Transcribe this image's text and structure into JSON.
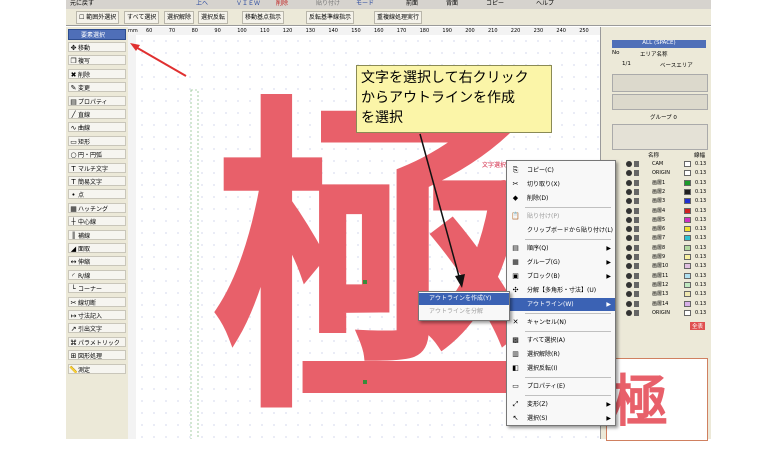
{
  "toolbar_top": {
    "back_label": "元に戻す",
    "items": [
      "上へ",
      "ＶＩＥＷ",
      "削除",
      "貼り付け",
      "モード",
      "前面",
      "背面",
      "コピー",
      "ヘルプ"
    ]
  },
  "toolbar_second": {
    "range_select": "範囲外選択",
    "select_all": "すべて選択",
    "deselect": "選択解除",
    "reverse": "選択反転",
    "move_base": "移動基点指示",
    "reverse_base": "反転基準線指示",
    "duplicate": "重複線処理実行"
  },
  "palette": {
    "select_label": "要素選択",
    "tools": [
      "移動",
      "複写",
      "削除",
      "変更",
      "プロパティ",
      "直線",
      "曲線",
      "矩形",
      "円・円弧",
      "マルチ文字",
      "簡易文字",
      "点",
      "ハッチング",
      "中心線",
      "補線",
      "面取",
      "伸縮",
      "R/線",
      "コーナー",
      "線切断",
      "寸法記入",
      "引出文字",
      "パラメトリック",
      "図形処理",
      "測定"
    ]
  },
  "ruler": {
    "unit": "mm",
    "ticks": [
      "60",
      "70",
      "80",
      "90",
      "100",
      "110",
      "120",
      "130",
      "140",
      "150",
      "160",
      "170",
      "180",
      "190",
      "200",
      "210",
      "220",
      "230",
      "240",
      "250"
    ]
  },
  "canvas": {
    "big_character": "極",
    "selection_label": "文字選択"
  },
  "callout": {
    "lines": [
      "文字を選択して右クリック",
      "からアウトラインを作成",
      "を選択"
    ]
  },
  "context_menu": {
    "items": [
      {
        "label": "コピー(C)",
        "icon": "copy-icon",
        "disabled": false
      },
      {
        "label": "切り取り(X)",
        "icon": "scissors-icon",
        "disabled": false
      },
      {
        "label": "削除(D)",
        "icon": "delete-icon",
        "disabled": false
      },
      {
        "label": "貼り付け(P)",
        "icon": "paste-icon",
        "disabled": true
      },
      {
        "label": "クリップボードから貼り付け(L)",
        "icon": "",
        "disabled": false
      },
      {
        "label": "順序(Q)",
        "icon": "order-icon",
        "disabled": false,
        "submenu": true
      },
      {
        "label": "グループ(G)",
        "icon": "group-icon",
        "disabled": false,
        "submenu": true
      },
      {
        "label": "ブロック(B)",
        "icon": "block-icon",
        "disabled": false,
        "submenu": true
      },
      {
        "label": "分解【多角形・寸法】(U)",
        "icon": "explode-icon",
        "disabled": false
      },
      {
        "label": "アウトライン(W)",
        "icon": "",
        "disabled": false,
        "submenu": true,
        "highlight": true
      },
      {
        "label": "キャンセル(N)",
        "icon": "cancel-icon",
        "disabled": false
      },
      {
        "label": "すべて選択(A)",
        "icon": "select-all-icon",
        "disabled": false
      },
      {
        "label": "選択解除(R)",
        "icon": "deselect-icon",
        "disabled": false
      },
      {
        "label": "選択反転(I)",
        "icon": "invert-icon",
        "disabled": false
      },
      {
        "label": "プロパティ(E)",
        "icon": "properties-icon",
        "disabled": false
      },
      {
        "label": "変形(Z)",
        "icon": "transform-icon",
        "disabled": false,
        "submenu": true
      },
      {
        "label": "選択(S)",
        "icon": "select-icon",
        "disabled": false,
        "submenu": true
      }
    ]
  },
  "submenu": {
    "create": "アウトラインを作成(Y)",
    "second": "アウトラインを分解"
  },
  "layer_panel": {
    "header_all": "ALL",
    "header_space": "(SPACE)",
    "col_no": "No",
    "col_area": "エリア名称",
    "area_value": "1/1",
    "area_name": "ベースエリア",
    "group_label": "グループ",
    "group_value": "0",
    "layer_header_name": "名称",
    "layer_header_width": "線幅",
    "layers": [
      {
        "name": "CAM",
        "color": "#ffffff",
        "width": "0.13"
      },
      {
        "name": "ORIGIN",
        "color": "#ffffff",
        "width": "0.13"
      },
      {
        "name": "画層1",
        "color": "#1a9a2a",
        "width": "0.13"
      },
      {
        "name": "画層2",
        "color": "#202020",
        "width": "0.13"
      },
      {
        "name": "画層3",
        "color": "#2030d0",
        "width": "0.13"
      },
      {
        "name": "画層4",
        "color": "#d02020",
        "width": "0.13"
      },
      {
        "name": "画層5",
        "color": "#d030c0",
        "width": "0.13"
      },
      {
        "name": "画層6",
        "color": "#f0e030",
        "width": "0.13"
      },
      {
        "name": "画層7",
        "color": "#30c0d0",
        "width": "0.13"
      },
      {
        "name": "画層8",
        "color": "#b0d8a0",
        "width": "0.13"
      },
      {
        "name": "画層9",
        "color": "#f8f0a0",
        "width": "0.13"
      },
      {
        "name": "画層10",
        "color": "#e0c0e0",
        "width": "0.13"
      },
      {
        "name": "画層11",
        "color": "#b0e0f0",
        "width": "0.13"
      },
      {
        "name": "画層12",
        "color": "#c0e8c0",
        "width": "0.13"
      },
      {
        "name": "画層13",
        "color": "#f0e8b0",
        "width": "0.13"
      },
      {
        "name": "画層14",
        "color": "#d8b0e8",
        "width": "0.13"
      },
      {
        "name": "ORIGIN",
        "color": "#ffffff",
        "width": "0.13"
      }
    ],
    "footer_label": "全表"
  },
  "preview": {
    "character": "極"
  },
  "colors": {
    "accent": "#e8606a",
    "highlight": "#3b62b4",
    "callout": "#fbf5a8",
    "annotation_arrow": "#e03030"
  }
}
